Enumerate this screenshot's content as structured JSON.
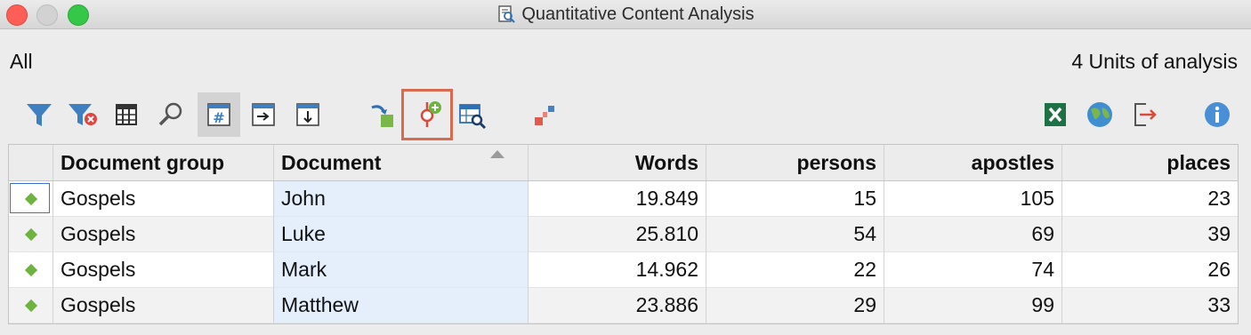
{
  "window": {
    "title": "Quantitative Content Analysis"
  },
  "header": {
    "scope_label": "All",
    "units_label": "4 Units of analysis"
  },
  "toolbar": {
    "items": [
      {
        "icon": "filter-icon"
      },
      {
        "icon": "clear-filter-icon"
      },
      {
        "icon": "columns-icon"
      },
      {
        "icon": "search-icon"
      },
      {
        "icon": "hash-frequency-icon",
        "state": "pressed"
      },
      {
        "icon": "arrow-right-icon"
      },
      {
        "icon": "arrow-down-icon"
      },
      {
        "icon": "transform-icon"
      },
      {
        "icon": "add-code-icon",
        "state": "highlighted"
      },
      {
        "icon": "table-search-icon"
      },
      {
        "icon": "code-matrix-icon"
      },
      {
        "icon": "excel-icon"
      },
      {
        "icon": "globe-icon"
      },
      {
        "icon": "export-icon"
      },
      {
        "icon": "info-icon"
      }
    ]
  },
  "table": {
    "columns": [
      "",
      "Document group",
      "Document",
      "Words",
      "persons",
      "apostles",
      "places"
    ],
    "sorted_column": "Document",
    "rows": [
      [
        "Gospels",
        "John",
        "19.849",
        "15",
        "105",
        "23"
      ],
      [
        "Gospels",
        "Luke",
        "25.810",
        "54",
        "69",
        "39"
      ],
      [
        "Gospels",
        "Mark",
        "14.962",
        "22",
        "74",
        "26"
      ],
      [
        "Gospels",
        "Matthew",
        "23.886",
        "29",
        "99",
        "33"
      ]
    ]
  },
  "colors": {
    "accent_highlight": "#d76a4f",
    "row_marker": "#6db33f",
    "selected_column": "#e4effb"
  }
}
